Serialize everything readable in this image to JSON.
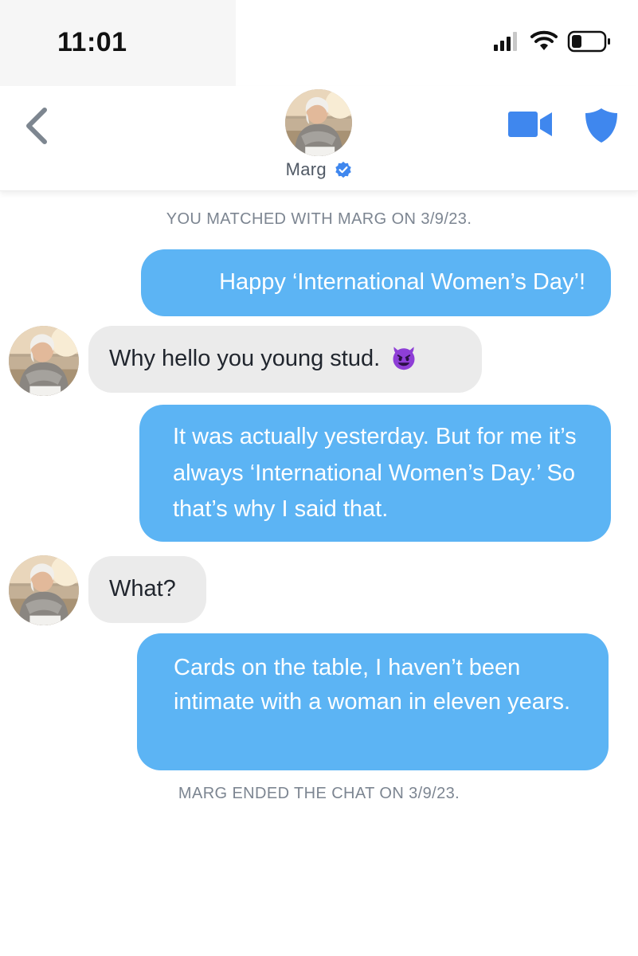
{
  "status_bar": {
    "time": "11:01"
  },
  "header": {
    "name": "Marg",
    "back_icon": "chevron-left-icon",
    "video_icon": "video-camera-icon",
    "safety_icon": "shield-icon",
    "verified_icon": "verified-badge-icon"
  },
  "chat": {
    "matched_note": "YOU MATCHED WITH MARG ON 3/9/23.",
    "ended_note": "MARG ENDED THE CHAT ON 3/9/23.",
    "messages": [
      {
        "sender": "me",
        "text": "Happy ‘International Women’s Day’!"
      },
      {
        "sender": "Marg",
        "text": "Why hello you young stud.",
        "emoji": "smiling-devil-emoji"
      },
      {
        "sender": "me",
        "text": "It was actually yesterday. But for me it’s always ‘International Women’s Day.’ So that’s why I said that."
      },
      {
        "sender": "Marg",
        "text": "What?"
      },
      {
        "sender": "me",
        "text": "Cards on the table, I haven’t been intimate with a woman in eleven years."
      }
    ]
  },
  "colors": {
    "outgoing_bubble": "#5cb4f4",
    "incoming_bubble": "#ebebeb",
    "accent_blue": "#3f87ee",
    "note_text": "#7c8591"
  }
}
